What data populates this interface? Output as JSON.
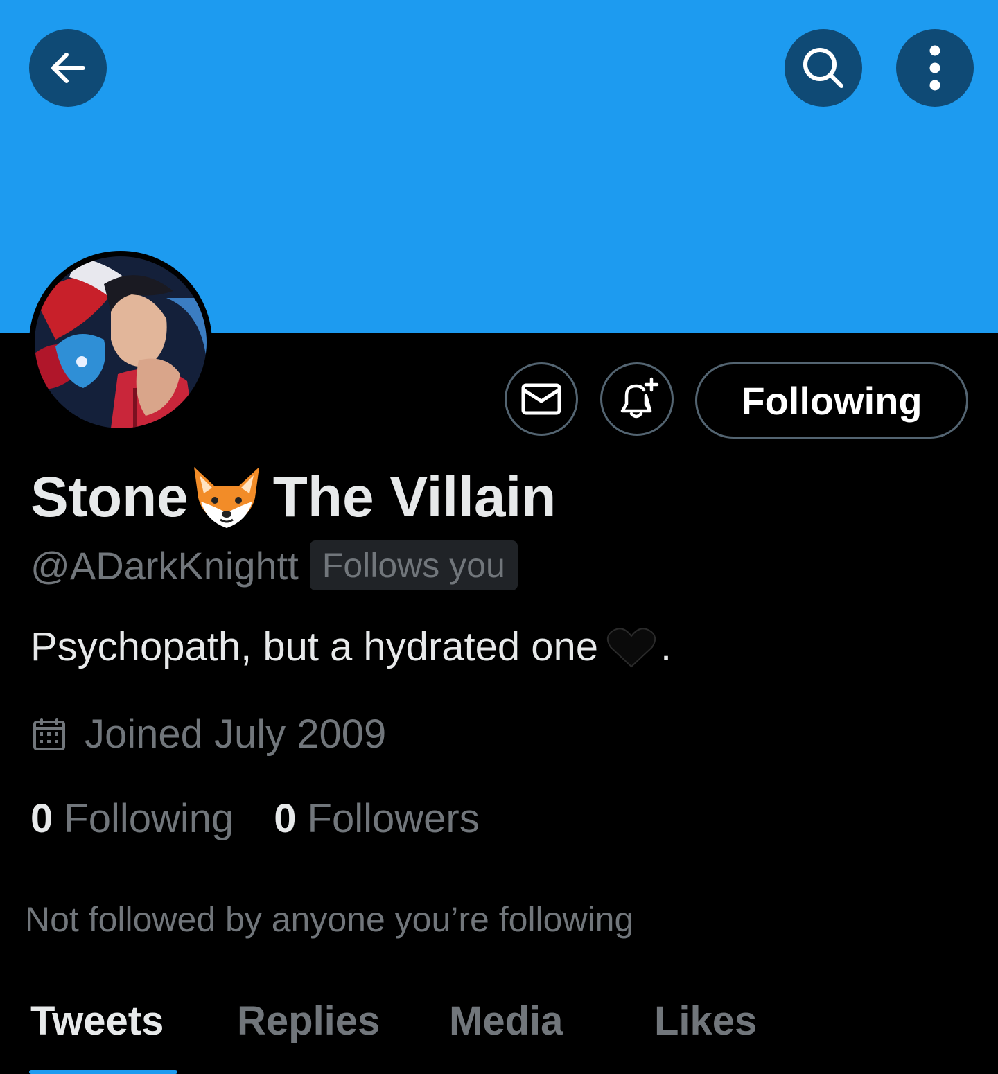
{
  "colors": {
    "banner": "#1d9bf0",
    "header_button_bg": "#0f4a75",
    "background": "#000000",
    "primary_text": "#e7e9ea",
    "secondary_text": "#71767b",
    "accent": "#1d9bf0"
  },
  "header": {
    "back_icon": "arrow-left-icon",
    "search_icon": "search-icon",
    "more_icon": "more-vertical-icon"
  },
  "profile": {
    "avatar_icon": "avatar-image",
    "name_part1": "Stone",
    "name_emoji": "fox-emoji",
    "name_part2": "The Villain",
    "handle": "@ADarkKnightt",
    "follows_you": "Follows you",
    "bio_text": "Psychopath, but a hydrated one",
    "bio_emoji": "black-heart-emoji",
    "bio_end": ".",
    "joined_icon": "calendar-icon",
    "joined": "Joined July 2009"
  },
  "actions": {
    "message_icon": "mail-icon",
    "notify_icon": "bell-plus-icon",
    "following_label": "Following"
  },
  "stats": {
    "following_count": "0",
    "following_label": "Following",
    "followers_count": "0",
    "followers_label": "Followers"
  },
  "mutuals_text": "Not followed by anyone you’re following",
  "tabs": [
    {
      "label": "Tweets",
      "active": true
    },
    {
      "label": "Replies",
      "active": false
    },
    {
      "label": "Media",
      "active": false
    },
    {
      "label": "Likes",
      "active": false
    }
  ]
}
